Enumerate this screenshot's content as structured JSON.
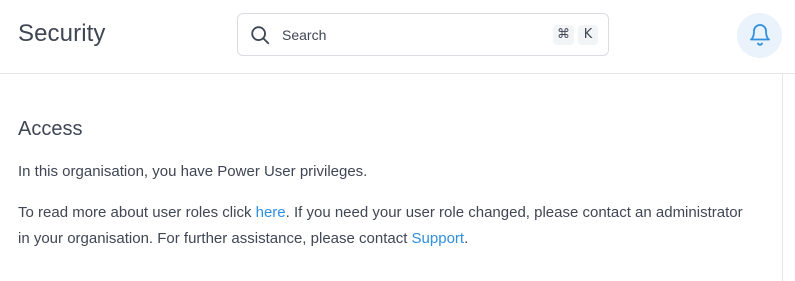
{
  "header": {
    "title": "Security",
    "search": {
      "placeholder": "Search",
      "shortcut_keys": [
        "⌘",
        "K"
      ],
      "icon": "search-icon"
    },
    "notifications_icon": "bell-icon"
  },
  "main": {
    "section_title": "Access",
    "intro_text": "In this organisation, you have Power User privileges.",
    "roles_text_before": "To read more about user roles click ",
    "roles_link": "here",
    "roles_text_after": ". If you need your user role changed, please contact an administrator in your organisation. For further assistance, please contact ",
    "support_link": "Support",
    "roles_text_end": "."
  },
  "colors": {
    "link": "#2f8fe0",
    "text": "#3f4654",
    "bell_bg": "#eaf2fb",
    "bell_stroke": "#2f8fe0"
  }
}
